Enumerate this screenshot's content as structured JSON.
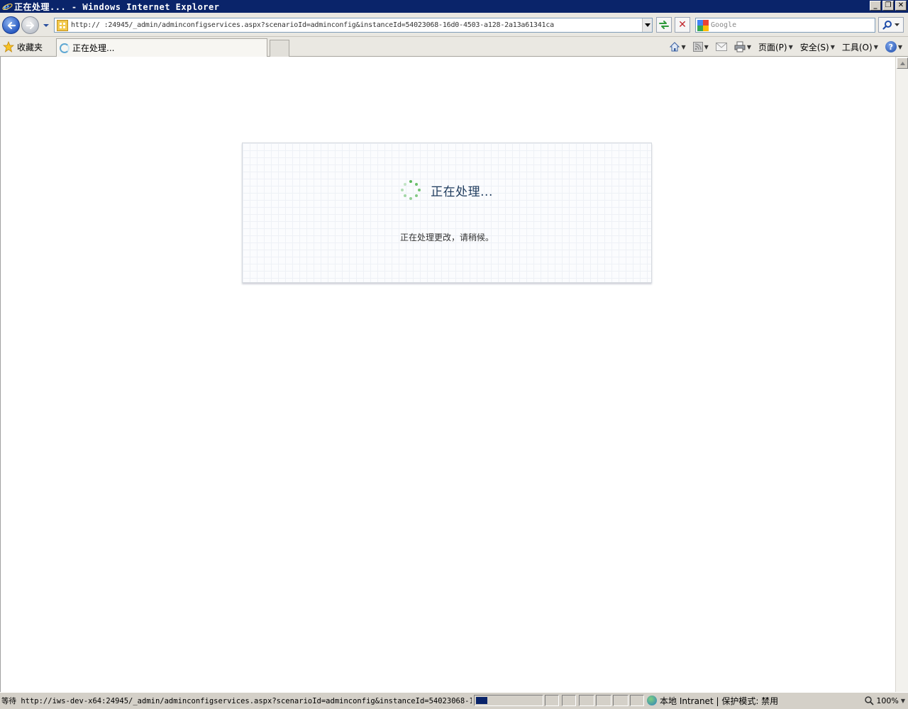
{
  "window": {
    "title": "正在处理... - Windows Internet Explorer",
    "min_label": "_",
    "max_label": "❐",
    "close_label": "✕"
  },
  "address_bar": {
    "url": "http://                 :24945/_admin/adminconfigservices.aspx?scenarioId=adminconfig&instanceId=54023068-16d0-4503-a128-2a13a61341ca"
  },
  "search": {
    "placeholder": "Google"
  },
  "favorites": {
    "label": "收藏夹"
  },
  "tab": {
    "label": "正在处理..."
  },
  "command_bar": {
    "page_label": "页面(P)",
    "safety_label": "安全(S)",
    "tools_label": "工具(O)",
    "help_label": "?"
  },
  "dialog": {
    "title": "正在处理...",
    "message": "正在处理更改，请稍候。"
  },
  "status_bar": {
    "text": "等待 http://iws-dev-x64:24945/_admin/adminconfigservices.aspx?scenarioId=adminconfig&instanceId=54023068-16d0-4",
    "progress": 0.17,
    "zone": "本地 Intranet | 保护模式: 禁用",
    "zoom": "100%"
  },
  "colors": {
    "title_bar": "#0a246a",
    "spinner": "#5cb85c",
    "dialog_title": "#1d3a5c"
  }
}
